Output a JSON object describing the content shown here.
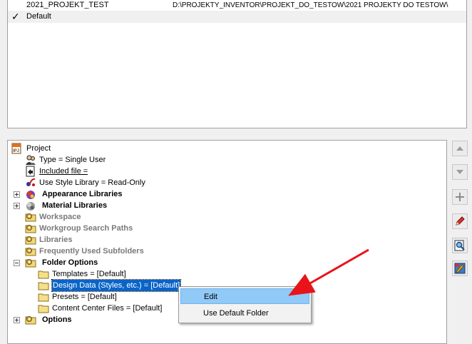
{
  "projects": [
    {
      "name": "2021_PROJEKT_TEST",
      "path": "D:\\PROJEKTY_INVENTOR\\PROJEKT_DO_TESTOW\\2021 PROJEKTY DO TESTOW\\",
      "active": false
    },
    {
      "name": "Default",
      "path": "",
      "active": true
    }
  ],
  "active_check": "✓",
  "tree": {
    "project": "Project",
    "type": "Type = Single User",
    "included_file": "Included file = ",
    "use_style_library": "Use Style Library = Read-Only",
    "appearance_libraries": "Appearance Libraries",
    "material_libraries": "Material Libraries",
    "workspace": "Workspace",
    "workgroup_search_paths": "Workgroup Search Paths",
    "libraries": "Libraries",
    "frequently_used_subfolders": "Frequently Used Subfolders",
    "folder_options": "Folder Options",
    "templates": "Templates = [Default]",
    "design_data": "Design Data (Styles, etc.) = [Default]",
    "presets": "Presets = [Default]",
    "content_center_files": "Content Center Files = [Default]",
    "options": "Options"
  },
  "context_menu": {
    "edit": "Edit",
    "use_default_folder": "Use Default Folder"
  },
  "colors": {
    "arrow": "#e8141a",
    "selection": "#0a64c8",
    "menu_highlight": "#91c9f7"
  },
  "side_buttons": [
    "arrow-up-icon",
    "arrow-down-icon",
    "add-icon",
    "edit-pencil-icon",
    "find-icon",
    "options-icon"
  ]
}
